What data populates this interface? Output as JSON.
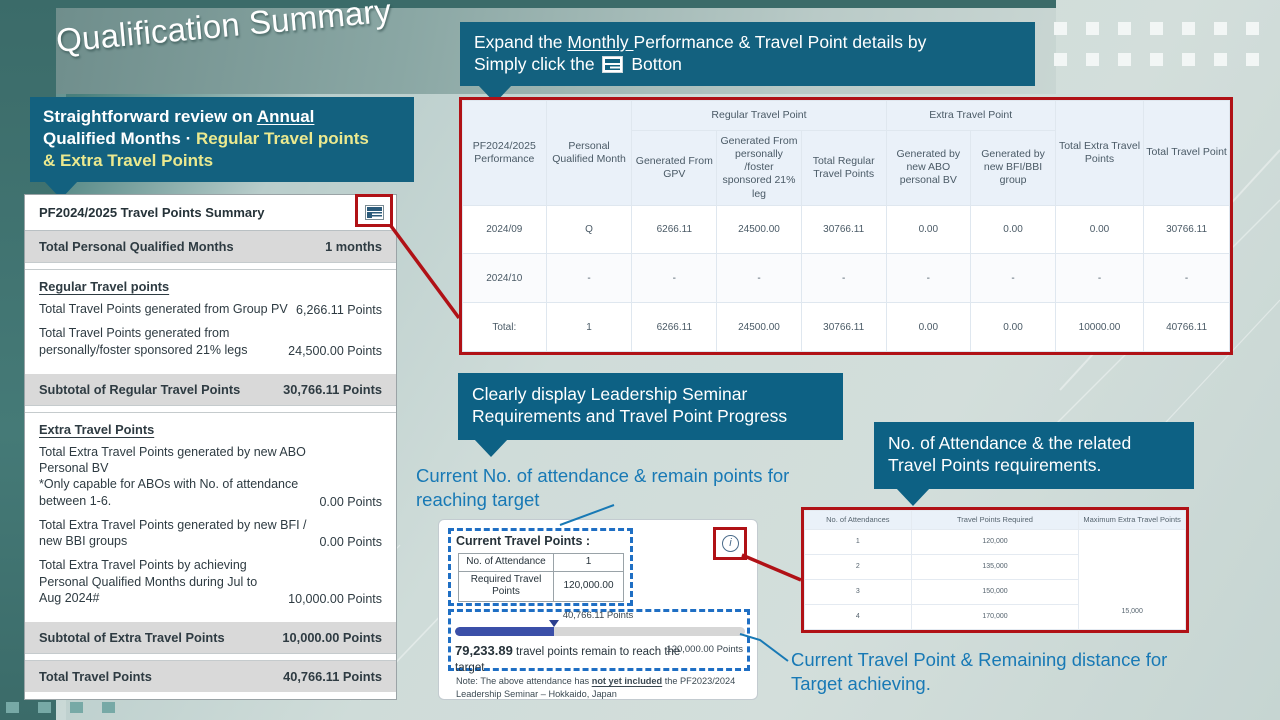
{
  "page": {
    "title": "Qualification Summary",
    "accent_teal": "#13617f",
    "accent_red": "#b01116",
    "accent_blue": "#1879b5"
  },
  "callouts": {
    "annual": {
      "line1_a": "Straightforward review on ",
      "line1_u": "Annual",
      "line2_a": "Qualified Months · ",
      "line2_y": "Regular Travel points",
      "line3_y": "& Extra Travel Points"
    },
    "expand": {
      "line1_a": "Expand the ",
      "line1_u": "Monthly ",
      "line1_b": "Performance & Travel Point details by",
      "line2_a": "Simply click the ",
      "line2_b": " Botton"
    },
    "leadership": {
      "line1": "Clearly display Leadership Seminar",
      "line2": "Requirements and Travel Point Progress"
    },
    "attendance": {
      "line1": "No. of Attendance & the related",
      "line2": "Travel Points requirements."
    }
  },
  "captions": {
    "current_attendance": "Current No. of attendance & remain points for reaching target",
    "current_travel_point": "Current Travel Point & Remaining distance for Target achieving."
  },
  "summary_panel": {
    "header": "PF2024/2025 Travel Points Summary",
    "grid_icon": "grid-table-icon",
    "qualified_months": {
      "label": "Total Personal Qualified Months",
      "value": "1 months"
    },
    "regular": {
      "title": "Regular Travel points",
      "lines": [
        {
          "label": "Total Travel Points generated from Group PV",
          "value": "6,266.11 Points"
        },
        {
          "label": "Total Travel Points generated from personally/foster sponsored 21% legs",
          "value": "24,500.00 Points"
        }
      ],
      "subtotal": {
        "label": "Subtotal of Regular Travel Points",
        "value": "30,766.11 Points"
      }
    },
    "extra": {
      "title": "Extra Travel Points",
      "lines": [
        {
          "label": "Total Extra Travel Points generated by new ABO Personal BV\n*Only capable for ABOs with No. of attendance between 1-6.",
          "value": "0.00 Points"
        },
        {
          "label": "Total Extra Travel Points generated by new BFI / new BBI groups",
          "value": "0.00 Points"
        },
        {
          "label": "Total Extra Travel Points by achieving Personal Qualified Months during Jul to Aug 2024#",
          "value": "10,000.00 Points"
        }
      ],
      "subtotal": {
        "label": "Subtotal of Extra Travel Points",
        "value": "10,000.00 Points"
      }
    },
    "total": {
      "label": "Total Travel Points",
      "value": "40,766.11 Points"
    }
  },
  "monthly_table": {
    "group_headers": [
      {
        "label": "",
        "span": 2
      },
      {
        "label": "Regular Travel Point",
        "span": 3
      },
      {
        "label": "Extra Travel Point",
        "span": 2
      },
      {
        "label": "",
        "span": 2
      }
    ],
    "columns": [
      "PF2024/2025 Performance",
      "Personal Qualified Month",
      "Generated From GPV",
      "Generated From personally /foster sponsored 21% leg",
      "Total Regular Travel Points",
      "Generated by new ABO personal BV",
      "Generated by new BFI/BBI group",
      "Total Extra Travel Points",
      "Total Travel Point"
    ],
    "rows": [
      [
        "2024/09",
        "Q",
        "6266.11",
        "24500.00",
        "30766.11",
        "0.00",
        "0.00",
        "0.00",
        "30766.11"
      ],
      [
        "2024/10",
        "-",
        "-",
        "-",
        "-",
        "-",
        "-",
        "-",
        "-"
      ],
      [
        "Total:",
        "1",
        "6266.11",
        "24500.00",
        "30766.11",
        "0.00",
        "0.00",
        "10000.00",
        "40766.11"
      ]
    ]
  },
  "current_travel_points": {
    "title": "Current Travel Points :",
    "info_icon": "info-circle-icon",
    "mini_rows": [
      {
        "label": "No. of Attendance",
        "value": "1"
      },
      {
        "label": "Required Travel Points",
        "value": "120,000.00"
      }
    ],
    "progress": {
      "current_label": "40,766.11 Points",
      "target_label": "120,000.00 Points",
      "current_value": 40766.11,
      "target_value": 120000.0,
      "percent": 34
    },
    "remaining_value": "79,233.89",
    "remaining_text": "travel points remain to reach the target",
    "note_a": "Note: The above attendance has ",
    "note_b": "not yet included",
    "note_c": " the PF2023/2024 Leadership Seminar – Hokkaido, Japan"
  },
  "attendance_table": {
    "columns": [
      "No. of Attendances",
      "Travel Points Required",
      "Maximum Extra Travel Points"
    ],
    "rows": [
      [
        "1",
        "120,000",
        ""
      ],
      [
        "2",
        "135,000",
        ""
      ],
      [
        "3",
        "150,000",
        ""
      ],
      [
        "4",
        "170,000",
        "15,000"
      ]
    ],
    "max_extra_value": "15,000"
  }
}
